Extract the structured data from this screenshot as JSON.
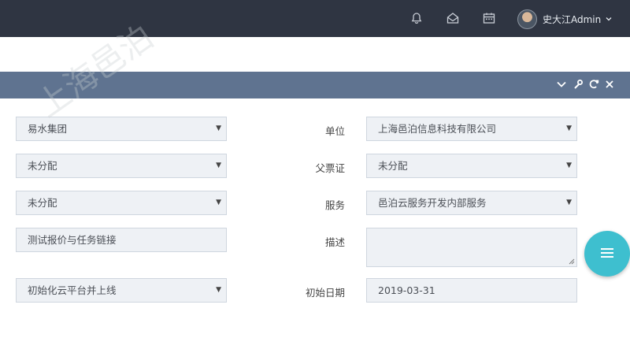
{
  "header": {
    "user_name": "史大江Admin",
    "icons": [
      "bell-icon",
      "envelope-open-icon",
      "calendar-icon",
      "chevron-down-icon"
    ]
  },
  "panel": {
    "tools": [
      "chevron-down-icon",
      "wrench-icon",
      "refresh-icon",
      "close-icon"
    ]
  },
  "form": {
    "group_value": "易水集团",
    "unit_label": "单位",
    "unit_value": "上海邑泊信息科技有限公司",
    "status_value": "未分配",
    "parent_ticket_label": "父票证",
    "parent_ticket_value": "未分配",
    "assignee_value": "未分配",
    "service_label": "服务",
    "service_value": "邑泊云服务开发内部服务",
    "title_value": "测试报价与任务链接",
    "description_label": "描述",
    "description_value": "",
    "stage_value": "初始化云平台并上线",
    "start_date_label": "初始日期",
    "start_date_value": "2019-03-31"
  },
  "watermark_text": "上海邑泊",
  "colors": {
    "topbar": "#2f3542",
    "panel_header": "#5f7390",
    "field_bg": "#eef1f5",
    "fab": "#3ebfcf"
  }
}
